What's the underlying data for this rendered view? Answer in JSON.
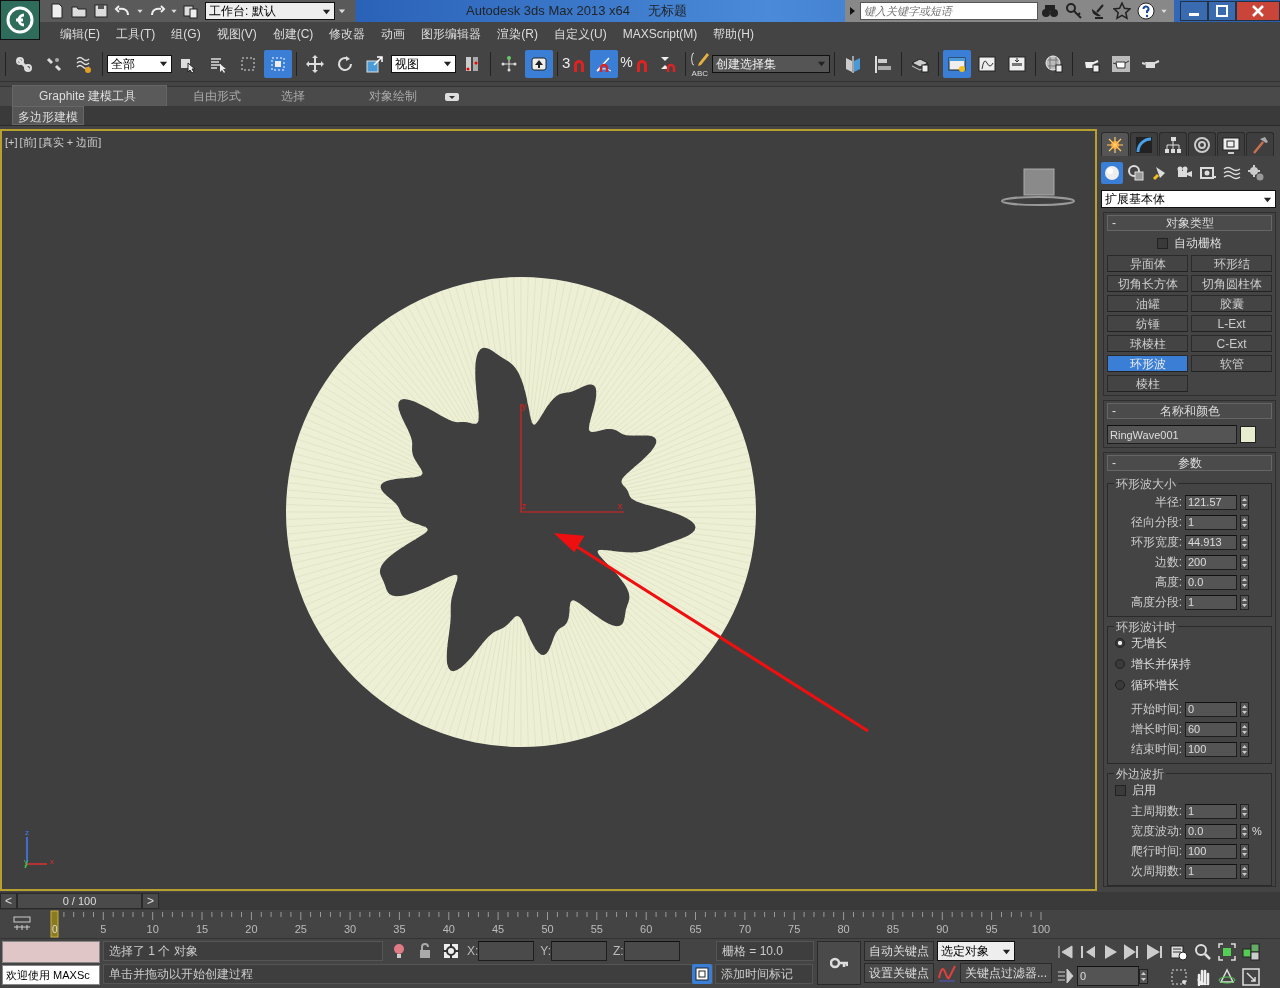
{
  "title_bar": {
    "workspace": "工作台: 默认",
    "app_title": "Autodesk 3ds Max  2013 x64",
    "document": "无标题",
    "search": {
      "placeholder": "键入关键字或短语"
    }
  },
  "menu": [
    "编辑(E)",
    "工具(T)",
    "组(G)",
    "视图(V)",
    "创建(C)",
    "修改器",
    "动画",
    "图形编辑器",
    "渲染(R)",
    "自定义(U)",
    "MAXScript(M)",
    "帮助(H)"
  ],
  "toolbar": {
    "selection_filter": "全部",
    "coordinate_system": "视图",
    "snap_label": "3",
    "percent_label": "%",
    "named_sets_label": "ABC",
    "named_selection": "创建选择集"
  },
  "ribbon": {
    "tabs": [
      {
        "label": "Graphite 建模工具",
        "selected": true
      },
      {
        "label": "自由形式",
        "selected": false
      },
      {
        "label": "选择",
        "selected": false
      },
      {
        "label": "对象绘制",
        "selected": false
      }
    ],
    "panel": "多边形建模"
  },
  "viewport": {
    "label": [
      "[+]",
      "[前]",
      "[真实 + 边面]"
    ],
    "gizmo_labels": [
      "y",
      "z",
      "x"
    ],
    "world_axis_labels": [
      "z",
      "y",
      "x"
    ]
  },
  "command_panel": {
    "tabs": [
      {
        "kind": "create",
        "selected": true
      },
      {
        "kind": "modify",
        "selected": false
      },
      {
        "kind": "hierarchy",
        "selected": false
      },
      {
        "kind": "motion",
        "selected": false
      },
      {
        "kind": "display",
        "selected": false
      },
      {
        "kind": "utilities",
        "selected": false
      }
    ],
    "categories": [
      {
        "kind": "geometry",
        "selected": true
      },
      {
        "kind": "shapes",
        "selected": false
      },
      {
        "kind": "lights",
        "selected": false
      },
      {
        "kind": "cameras",
        "selected": false
      },
      {
        "kind": "helpers",
        "selected": false
      },
      {
        "kind": "spacewarps",
        "selected": false
      },
      {
        "kind": "systems",
        "selected": false
      }
    ],
    "category_dropdown": "扩展基本体",
    "object_type": {
      "title": "对象类型",
      "autogrid": {
        "label": "自动栅格",
        "checked": false
      },
      "buttons": [
        {
          "label": "异面体",
          "selected": false
        },
        {
          "label": "环形结",
          "selected": false
        },
        {
          "label": "切角长方体",
          "selected": false
        },
        {
          "label": "切角圆柱体",
          "selected": false
        },
        {
          "label": "油罐",
          "selected": false
        },
        {
          "label": "胶囊",
          "selected": false
        },
        {
          "label": "纺锤",
          "selected": false
        },
        {
          "label": "L-Ext",
          "selected": false
        },
        {
          "label": "球棱柱",
          "selected": false
        },
        {
          "label": "C-Ext",
          "selected": false
        },
        {
          "label": "环形波",
          "selected": true
        },
        {
          "label": "软管",
          "selected": false
        },
        {
          "label": "棱柱",
          "selected": false
        }
      ]
    },
    "name_color": {
      "title": "名称和颜色",
      "name": "RingWave001",
      "color": "#e9edcf"
    },
    "parameters": {
      "title": "参数",
      "groups": [
        {
          "title": "环形波大小",
          "fields": [
            {
              "label": "半径:",
              "value": "121.57"
            },
            {
              "label": "径向分段:",
              "value": "1"
            },
            {
              "label": "环形宽度:",
              "value": "44.913"
            },
            {
              "label": "边数:",
              "value": "200"
            },
            {
              "label": "高度:",
              "value": "0.0"
            },
            {
              "label": "高度分段:",
              "value": "1"
            }
          ]
        },
        {
          "title": "环形波计时",
          "radios": [
            {
              "label": "无增长",
              "selected": true
            },
            {
              "label": "增长并保持",
              "selected": false
            },
            {
              "label": "循环增长",
              "selected": false
            }
          ],
          "fields": [
            {
              "label": "开始时间:",
              "value": "0"
            },
            {
              "label": "增长时间:",
              "value": "60"
            },
            {
              "label": "结束时间:",
              "value": "100"
            }
          ]
        },
        {
          "title": "外边波折",
          "checkbox": {
            "label": "启用",
            "checked": false
          },
          "fields": [
            {
              "label": "主周期数:",
              "value": "1"
            },
            {
              "label": "宽度波动:",
              "value": "0.0",
              "unit": "%"
            },
            {
              "label": "爬行时间:",
              "value": "100"
            },
            {
              "label": "次周期数:",
              "value": "1"
            }
          ]
        }
      ]
    }
  },
  "rollout_collapse": [
    "-",
    "-",
    "-"
  ],
  "timeline": {
    "prev": "<",
    "position": "0 / 100",
    "next": ">",
    "current": "0",
    "ticks": [
      "5",
      "10",
      "15",
      "20",
      "25",
      "30",
      "35",
      "40",
      "45",
      "50",
      "55",
      "60",
      "65",
      "70",
      "75",
      "80",
      "85",
      "90",
      "95",
      "100"
    ]
  },
  "status": {
    "listener": "欢迎使用 MAXSc",
    "selection": "选择了 1 个 对象",
    "prompt": "单击并拖动以开始创建过程",
    "x_label": "X:",
    "y_label": "Y:",
    "z_label": "Z:",
    "grid": "栅格 = 10.0",
    "add_tag": "添加时间标记",
    "auto_key": "自动关键点",
    "set_key": "设置关键点",
    "key_mode": "选定对象",
    "key_filters": "关键点过滤器...",
    "frame": "0"
  }
}
